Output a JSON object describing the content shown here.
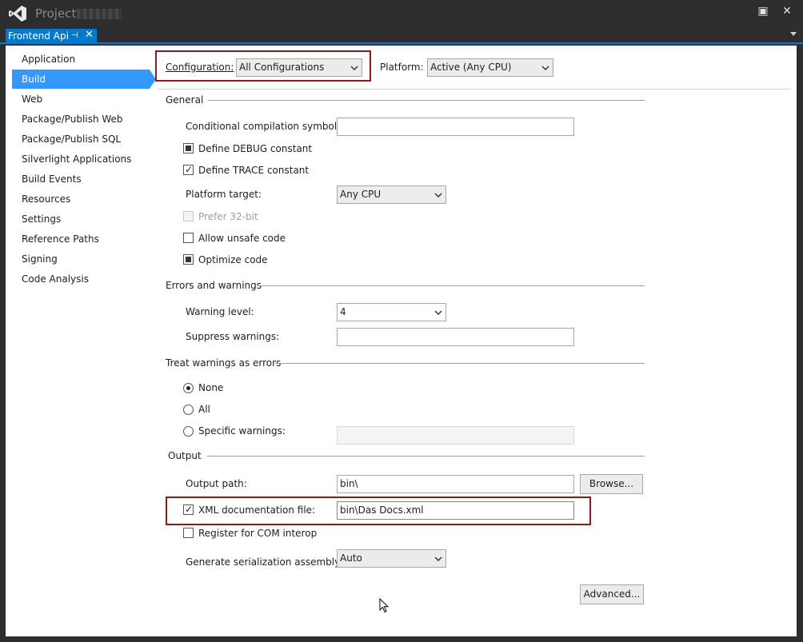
{
  "window": {
    "title": "Project",
    "maximize_symbol": "▣",
    "close_symbol": "✕"
  },
  "tab": {
    "label": "Frontend Api",
    "pin_symbol": "⊣",
    "close_symbol": "✕"
  },
  "nav": {
    "items": [
      {
        "label": "Application"
      },
      {
        "label": "Build"
      },
      {
        "label": "Web"
      },
      {
        "label": "Package/Publish Web"
      },
      {
        "label": "Package/Publish SQL"
      },
      {
        "label": "Silverlight Applications"
      },
      {
        "label": "Build Events"
      },
      {
        "label": "Resources"
      },
      {
        "label": "Settings"
      },
      {
        "label": "Reference Paths"
      },
      {
        "label": "Signing"
      },
      {
        "label": "Code Analysis"
      }
    ],
    "active": "Build"
  },
  "header": {
    "configuration_label": "Configuration:",
    "configuration_value": "All Configurations",
    "platform_label": "Platform:",
    "platform_value": "Active (Any CPU)"
  },
  "general": {
    "title": "General",
    "conditional_label": "Conditional compilation symbols:",
    "conditional_value": "",
    "define_debug_label": "Define DEBUG constant",
    "define_debug_state": "indeterminate",
    "define_trace_label": "Define TRACE constant",
    "define_trace_state": "checked",
    "platform_target_label": "Platform target:",
    "platform_target_value": "Any CPU",
    "prefer32_label": "Prefer 32-bit",
    "prefer32_state": "disabled-unchecked",
    "unsafe_label": "Allow unsafe code",
    "unsafe_state": "unchecked",
    "optimize_label": "Optimize code",
    "optimize_state": "indeterminate"
  },
  "errors": {
    "title": "Errors and warnings",
    "warning_level_label": "Warning level:",
    "warning_level_value": "4",
    "suppress_label": "Suppress warnings:",
    "suppress_value": ""
  },
  "treat_warnings": {
    "title": "Treat warnings as errors",
    "none_label": "None",
    "all_label": "All",
    "specific_label": "Specific warnings:",
    "specific_value": "",
    "selected": "None"
  },
  "output": {
    "title": "Output",
    "output_path_label": "Output path:",
    "output_path_value": "bin\\",
    "browse_label": "Browse...",
    "xml_doc_label": "XML documentation file:",
    "xml_doc_state": "checked",
    "xml_doc_value": "bin\\Das Docs.xml",
    "com_interop_label": "Register for COM interop",
    "com_interop_state": "unchecked",
    "serialization_label": "Generate serialization assembly:",
    "serialization_value": "Auto",
    "advanced_label": "Advanced..."
  },
  "colors": {
    "accent": "#007acc",
    "nav_selected": "#3399ff",
    "highlight_box": "#8b1a1a",
    "chrome": "#2d2d30"
  }
}
